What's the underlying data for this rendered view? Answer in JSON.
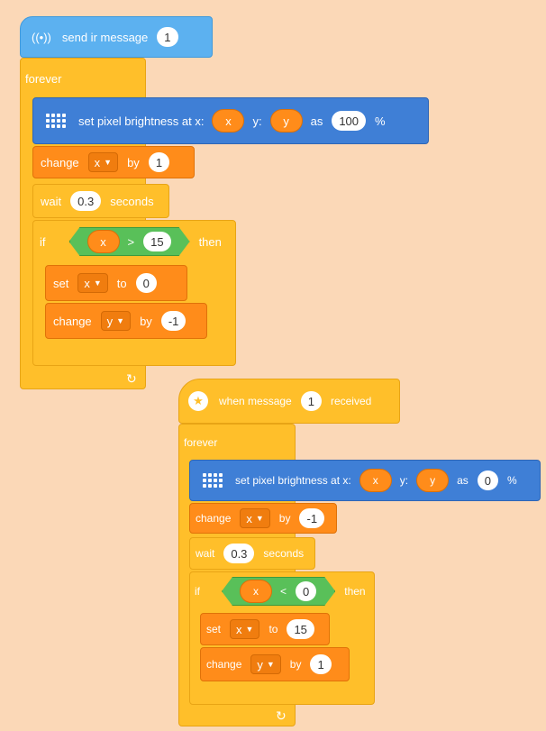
{
  "script1": {
    "hat": {
      "label": "send ir message",
      "value": "1",
      "icon": "broadcast-icon"
    },
    "forever": {
      "label": "forever",
      "loop_icon": "loop-arrow-icon"
    },
    "set_pixel": {
      "label": "set pixel brightness at x:",
      "x": "x",
      "y_label": "y:",
      "y": "y",
      "as_label": "as",
      "value": "100",
      "unit": "%"
    },
    "change_x": {
      "label": "change",
      "var": "x",
      "by_label": "by",
      "value": "1"
    },
    "wait": {
      "label": "wait",
      "value": "0.3",
      "unit": "seconds"
    },
    "if": {
      "label": "if",
      "var": "x",
      "op": ">",
      "value": "15",
      "then_label": "then"
    },
    "set_x": {
      "label": "set",
      "var": "x",
      "to_label": "to",
      "value": "0"
    },
    "change_y": {
      "label": "change",
      "var": "y",
      "by_label": "by",
      "value": "-1"
    }
  },
  "script2": {
    "hat": {
      "label": "when message",
      "value": "1",
      "suffix": "received",
      "icon": "message-icon"
    },
    "forever": {
      "label": "forever",
      "loop_icon": "loop-arrow-icon"
    },
    "set_pixel": {
      "label": "set pixel brightness at x:",
      "x": "x",
      "y_label": "y:",
      "y": "y",
      "as_label": "as",
      "value": "0",
      "unit": "%"
    },
    "change_x": {
      "label": "change",
      "var": "x",
      "by_label": "by",
      "value": "-1"
    },
    "wait": {
      "label": "wait",
      "value": "0.3",
      "unit": "seconds"
    },
    "if": {
      "label": "if",
      "var": "x",
      "op": "<",
      "value": "0",
      "then_label": "then"
    },
    "set_x": {
      "label": "set",
      "var": "x",
      "to_label": "to",
      "value": "15"
    },
    "change_y": {
      "label": "change",
      "var": "y",
      "by_label": "by",
      "value": "1"
    }
  },
  "colors": {
    "background": "#fbd8b7",
    "event": "#5cb1f0",
    "looks": "#3f7fd6",
    "variables": "#ff8c1a",
    "control": "#ffbf2a",
    "operators": "#59c059"
  }
}
